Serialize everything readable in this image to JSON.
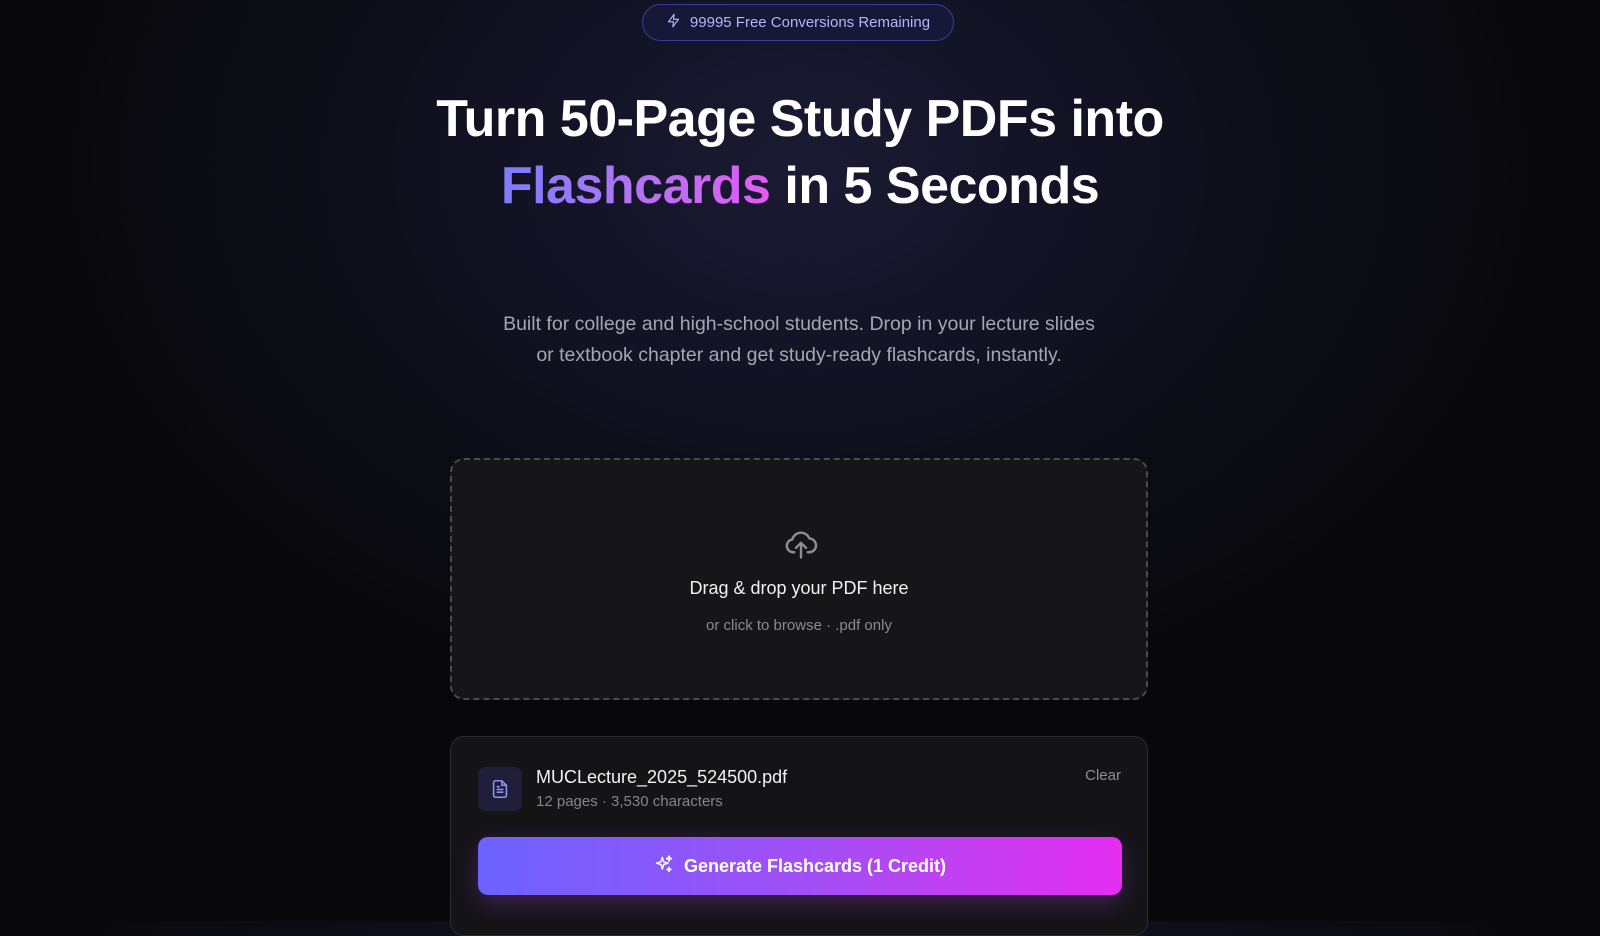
{
  "badge": {
    "icon": "lightning-icon",
    "text": "99995 Free Conversions Remaining"
  },
  "hero": {
    "headline_part1": "Turn 50-Page Study PDFs into ",
    "headline_highlight": "Flashcards",
    "headline_part2": " in 5 Seconds",
    "subtitle": "Built for college and high-school students. Drop in your lecture slides or textbook chapter and get study-ready flashcards, instantly."
  },
  "dropzone": {
    "icon": "cloud-upload-icon",
    "title": "Drag & drop your PDF here",
    "subtitle": "or click to browse · .pdf only"
  },
  "file": {
    "icon": "document-icon",
    "name": "MUCLecture_2025_524500.pdf",
    "meta": "12 pages · 3,530 characters",
    "clear_label": "Clear"
  },
  "generate": {
    "icon": "sparkles-icon",
    "label": "Generate Flashcards (1 Credit)"
  },
  "colors": {
    "accent_start": "#6b63ff",
    "accent_end": "#e52ef2",
    "badge_text": "#b3b8f5",
    "background": "#0d0d17"
  }
}
